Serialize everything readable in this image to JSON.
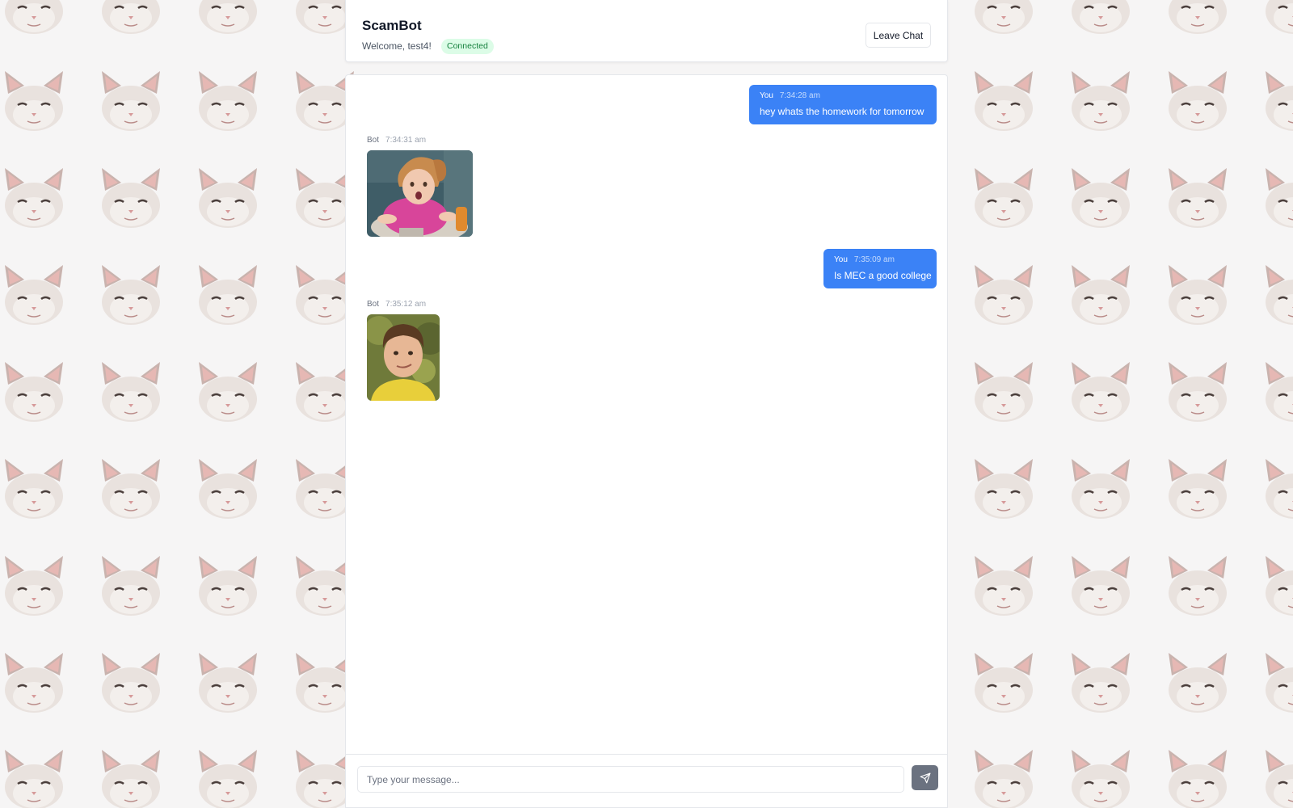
{
  "header": {
    "title": "ScamBot",
    "welcome": "Welcome, test4!",
    "status": "Connected",
    "leave_label": "Leave Chat"
  },
  "messages": [
    {
      "sender": "You",
      "time": "7:34:28 am",
      "text": "hey whats the homework for tomorrow"
    },
    {
      "sender": "Bot",
      "time": "7:34:31 am",
      "image": "little-girl-shrug-meme"
    },
    {
      "sender": "You",
      "time": "7:35:09 am",
      "text": "Is MEC a good college"
    },
    {
      "sender": "Bot",
      "time": "7:35:12 am",
      "image": "kid-smirk-meme"
    }
  ],
  "composer": {
    "placeholder": "Type your message...",
    "send_icon": "send-icon"
  },
  "background": {
    "pattern": "white-cat-tile"
  },
  "colors": {
    "accent": "#3b82f6",
    "connected_bg": "#dcfce7",
    "connected_text": "#15803d",
    "send_button": "#6b7280"
  }
}
